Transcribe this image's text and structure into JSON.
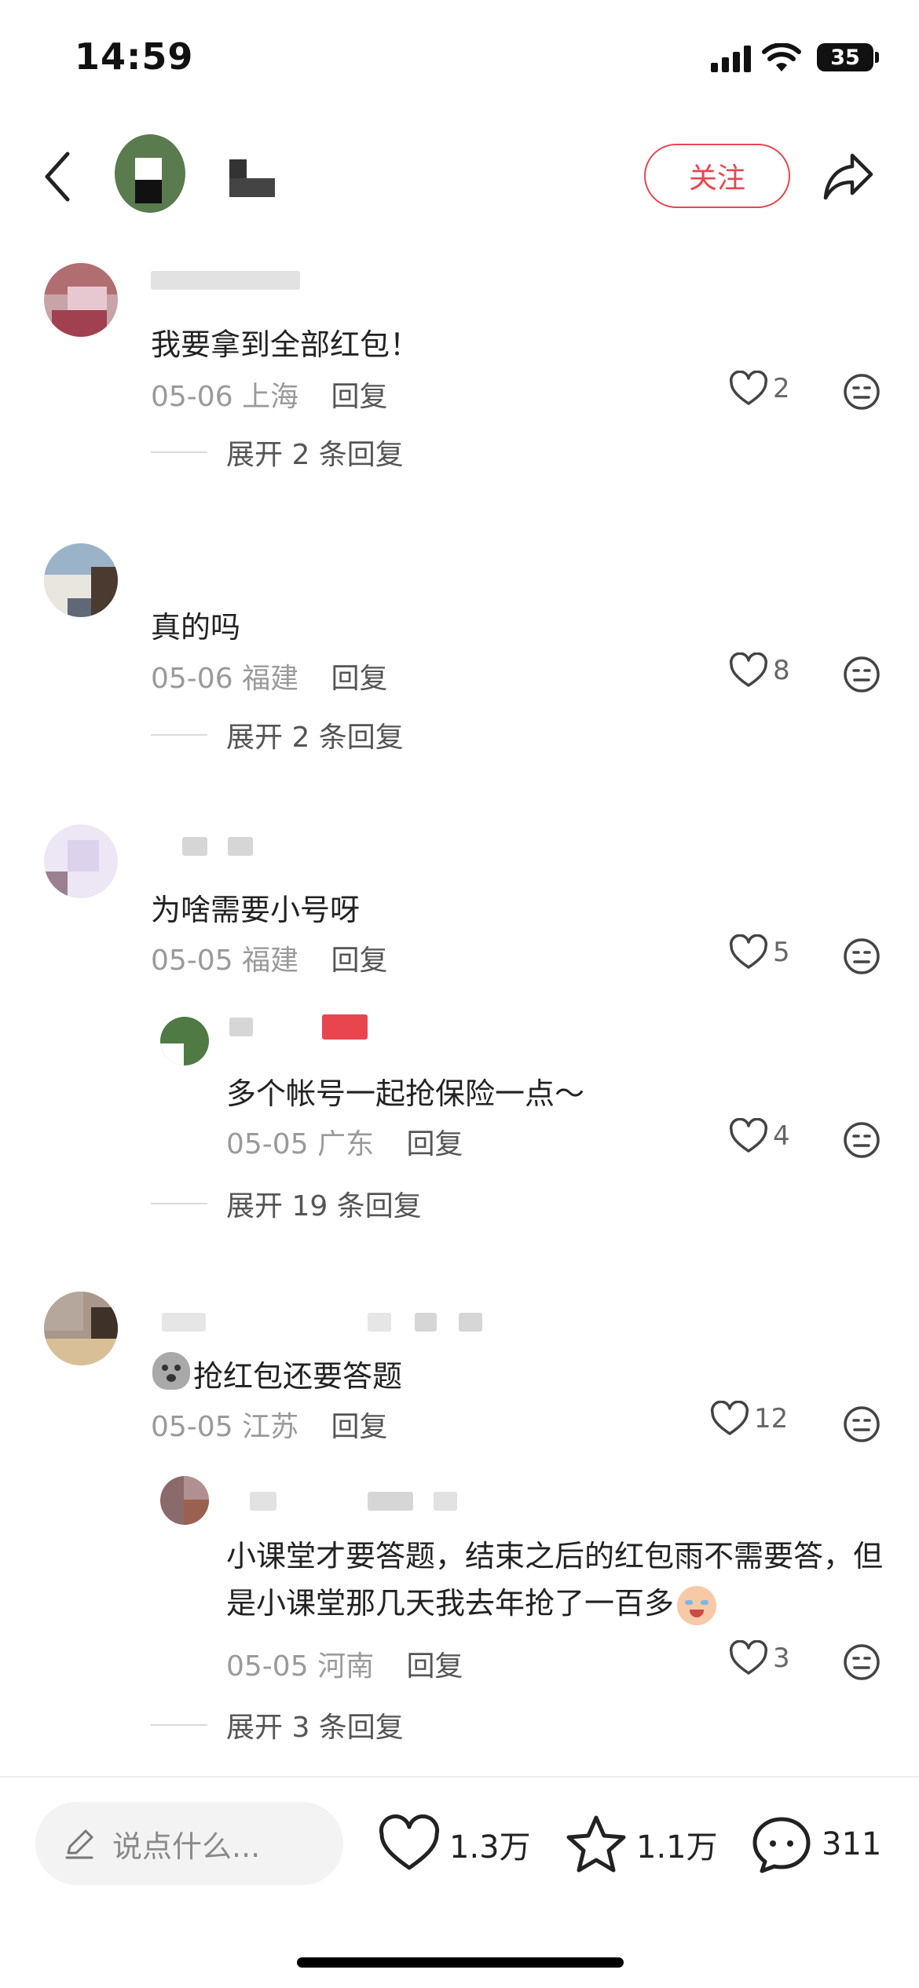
{
  "status_bar": {
    "time": "14:59",
    "battery": "35"
  },
  "header": {
    "follow_label": "关注"
  },
  "comments": [
    {
      "content": "我要拿到全部红包！",
      "date": "05-06",
      "location": "上海",
      "reply_label": "回复",
      "likes": "2",
      "expand_label": "展开 2 条回复"
    },
    {
      "content": "真的吗",
      "date": "05-06",
      "location": "福建",
      "reply_label": "回复",
      "likes": "8",
      "expand_label": "展开 2 条回复"
    },
    {
      "content": "为啥需要小号呀",
      "date": "05-05",
      "location": "福建",
      "reply_label": "回复",
      "likes": "5",
      "sub_reply": {
        "content": "多个帐号一起抢保险一点～",
        "date": "05-05",
        "location": "广东",
        "reply_label": "回复",
        "likes": "4"
      },
      "expand_label": "展开 19 条回复"
    },
    {
      "content": "抢红包还要答题",
      "date": "05-05",
      "location": "江苏",
      "reply_label": "回复",
      "likes": "12",
      "sub_reply": {
        "content": "小课堂才要答题，结束之后的红包雨不需要答，但是小课堂那几天我去年抢了一百多",
        "date": "05-05",
        "location": "河南",
        "reply_label": "回复",
        "likes": "3"
      },
      "expand_label": "展开 3 条回复"
    }
  ],
  "bottom_bar": {
    "input_placeholder": "说点什么...",
    "likes": "1.3万",
    "favorites": "1.1万",
    "comments": "311"
  },
  "colors": {
    "accent": "#e9454f"
  },
  "icons": [
    "back-icon",
    "share-icon",
    "heart-icon",
    "dislike-icon",
    "pen-icon",
    "star-icon",
    "comment-icon"
  ]
}
